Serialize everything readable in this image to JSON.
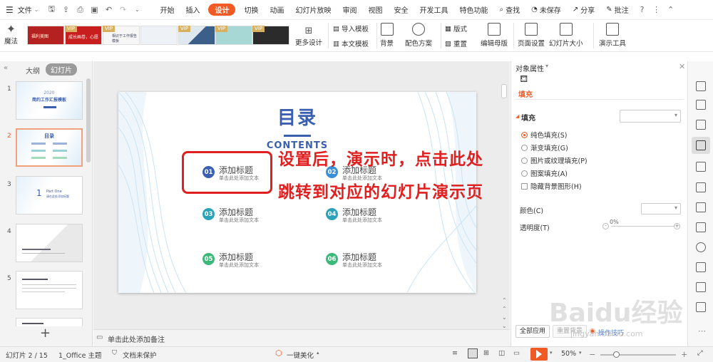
{
  "menubar": {
    "file": "文件",
    "tabs": [
      "开始",
      "插入",
      "设计",
      "切换",
      "动画",
      "幻灯片放映",
      "审阅",
      "视图",
      "安全",
      "开发工具",
      "特色功能"
    ],
    "active_tab": "设计",
    "search": "查找",
    "unsaved": "未保存",
    "share": "分享",
    "comment": "批注"
  },
  "ribbon": {
    "magic": "魔法",
    "vip_label": "VIP",
    "template_1_text": "福利美图",
    "template_2_text": "成长画卷，心愿",
    "template_3_text": "相识于工作报告模板",
    "more_designs": "更多设计",
    "import_template": "导入模板",
    "this_template": "本文模板",
    "background": "背景",
    "color_scheme": "配色方案",
    "layout": "版式",
    "reset": "重置",
    "edit_master": "编辑母版",
    "page_setup": "页面设置",
    "slide_size": "幻灯片大小",
    "presentation_tools": "演示工具"
  },
  "left_panel": {
    "tab_outline": "大纲",
    "tab_slides": "幻灯片",
    "slide_numbers": [
      "1",
      "2",
      "3",
      "4",
      "5"
    ],
    "thumb1_year": "2020",
    "thumb1_title": "简约工作汇报模板",
    "thumb2_title": "目录",
    "thumb3_num": "1",
    "thumb3_line1": "Part One",
    "thumb3_line2": "请在此处添加标题",
    "add_slide": "+"
  },
  "slide": {
    "title": "目录",
    "subtitle": "CONTENTS",
    "items": [
      {
        "num": "01",
        "title": "添加标题",
        "sub": "单击此处添加文本",
        "color": "#3a5fb0"
      },
      {
        "num": "02",
        "title": "添加标题",
        "sub": "单击此处添加文本",
        "color": "#3a8fd6"
      },
      {
        "num": "03",
        "title": "添加标题",
        "sub": "单击此处添加文本",
        "color": "#2aa3b8"
      },
      {
        "num": "04",
        "title": "添加标题",
        "sub": "单击此处添加文本",
        "color": "#2aa3b8"
      },
      {
        "num": "05",
        "title": "添加标题",
        "sub": "单击此处添加文本",
        "color": "#3cb878"
      },
      {
        "num": "06",
        "title": "添加标题",
        "sub": "单击此处添加文本",
        "color": "#3cb878"
      }
    ]
  },
  "annotation": {
    "line1": "设置后，演示时，点击此处",
    "line2": "跳转到对应的幻灯片演示页",
    "color": "#e02020"
  },
  "notes_placeholder": "单击此处添加备注",
  "right_panel": {
    "header": "对象属性",
    "fill_tab": "填充",
    "fill_section": "填充",
    "options": [
      "纯色填充(S)",
      "渐变填充(G)",
      "图片或纹理填充(P)",
      "图案填充(A)",
      "隐藏背景图形(H)"
    ],
    "color_label": "颜色(C)",
    "transparency_label": "透明度(T)",
    "transparency_value": "0%",
    "apply_all": "全部应用",
    "reset_bg": "重置背景",
    "tips": "操作技巧"
  },
  "statusbar": {
    "slide_counter": "幻灯片 2 / 15",
    "theme": "1_Office 主题",
    "doc_protect": "文档未保护",
    "beautify": "一键美化",
    "zoom": "50%",
    "minus": "－",
    "plus": "＋"
  },
  "watermark": {
    "brand": "Baidu经验",
    "url": "jingyan.baidu.com"
  },
  "colors": {
    "accent": "#f15a24",
    "slide_title": "#3a5fb0",
    "highlight_box": "#e02020"
  }
}
